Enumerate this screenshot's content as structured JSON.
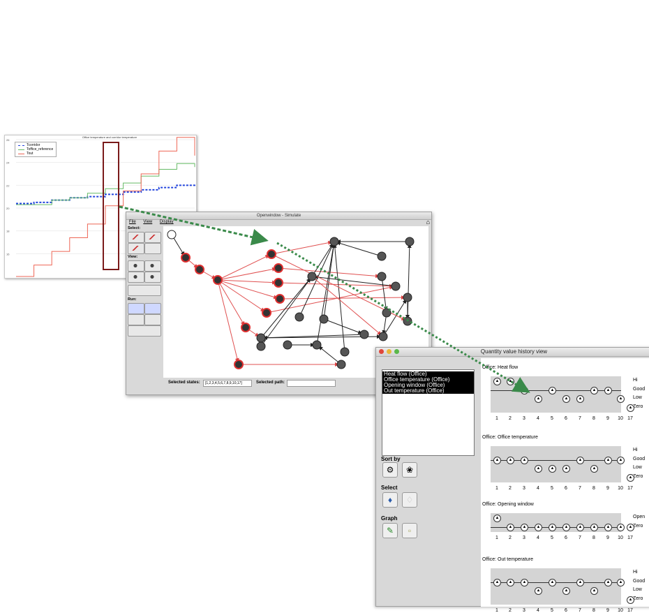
{
  "chart": {
    "title": "Office temperature and corridor temperature",
    "legend": [
      {
        "label": "Tcorridor",
        "color": "#2244dd"
      },
      {
        "label": "Toffice_reference",
        "color": "#66bb66"
      },
      {
        "label": "Tout",
        "color": "#ee6655"
      }
    ],
    "y_ticks": [
      "26",
      "24",
      "22",
      "20",
      "18",
      "16"
    ]
  },
  "chart_data": {
    "type": "line",
    "title": "Office temperature and corridor temperature",
    "xlabel": "",
    "ylabel": "",
    "ylim": [
      14,
      26
    ],
    "xlim": [
      0,
      100
    ],
    "series": [
      {
        "name": "Tcorridor",
        "x": [
          0,
          10,
          20,
          30,
          40,
          50,
          60,
          70,
          80,
          90,
          100
        ],
        "y": [
          20.4,
          20.5,
          20.7,
          20.9,
          21.0,
          21.2,
          21.4,
          21.6,
          21.8,
          22.0,
          22.1
        ]
      },
      {
        "name": "Toffice_reference",
        "x": [
          0,
          10,
          20,
          30,
          40,
          50,
          60,
          70,
          80,
          90,
          100
        ],
        "y": [
          20.3,
          20.3,
          20.7,
          20.9,
          21.3,
          21.7,
          22.2,
          22.8,
          23.4,
          23.9,
          23.6
        ]
      },
      {
        "name": "Tout",
        "x": [
          0,
          10,
          20,
          30,
          40,
          50,
          60,
          70,
          80,
          90,
          100
        ],
        "y": [
          14.0,
          15.0,
          16.2,
          17.4,
          18.6,
          20.2,
          21.5,
          23.0,
          25.0,
          26.2,
          24.6
        ]
      }
    ]
  },
  "sim": {
    "title": "Openwindow - Simulate",
    "menus": [
      "File",
      "View",
      "Display"
    ],
    "labels": {
      "select": "Select:",
      "view": "View:",
      "run": "Run:"
    },
    "selected_states_label": "Selected states:",
    "selected_states_value": "[1,2,3,4,5,6,7,8,9,10,17]",
    "selected_path_label": "Selected path:",
    "selected_path_value": ""
  },
  "qhv": {
    "title": "Quantity value history view",
    "quantities": [
      "Heat flow (Office)",
      "Office temperature (Office)",
      "Opening window (Office)",
      "Out temperature (Office)"
    ],
    "sort_label": "Sort by",
    "select_label": "Select",
    "graph_label": "Graph",
    "axis_labels": [
      "1",
      "2",
      "3",
      "4",
      "5",
      "6",
      "7",
      "8",
      "9",
      "10",
      "17"
    ],
    "groups": [
      {
        "title": "Office: Heat flow",
        "levels": [
          "Hi",
          "Good",
          "Low",
          "Zero"
        ],
        "values": [
          3,
          3,
          2,
          1,
          2,
          1,
          1,
          2,
          2,
          1,
          0
        ]
      },
      {
        "title": "Office: Office temperature",
        "levels": [
          "Hi",
          "Good",
          "Low",
          "Zero"
        ],
        "values": [
          2,
          2,
          2,
          1,
          1,
          1,
          2,
          1,
          2,
          2,
          0
        ]
      },
      {
        "title": "Office: Opening window",
        "levels": [
          "Open",
          "Zero"
        ],
        "values": [
          1,
          0,
          0,
          0,
          0,
          0,
          0,
          0,
          0,
          0,
          0
        ]
      },
      {
        "title": "Office: Out temperature",
        "levels": [
          "Hi",
          "Good",
          "Low",
          "Zero"
        ],
        "values": [
          2,
          2,
          2,
          1,
          2,
          1,
          2,
          1,
          2,
          2,
          0
        ]
      }
    ]
  }
}
